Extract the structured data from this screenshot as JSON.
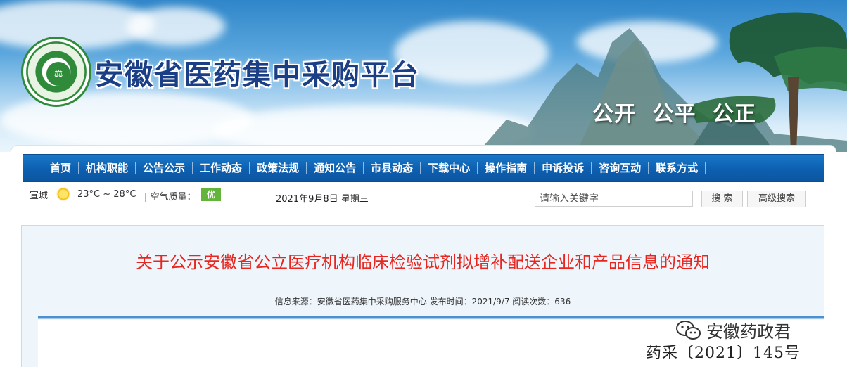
{
  "header": {
    "site_title": "安徽省医药集中采购平台",
    "slogan": [
      "公开",
      "公平",
      "公正"
    ]
  },
  "nav": {
    "items": [
      "首页",
      "机构职能",
      "公告公示",
      "工作动态",
      "政策法规",
      "通知公告",
      "市县动态",
      "下载中心",
      "操作指南",
      "申诉投诉",
      "咨询互动",
      "联系方式"
    ]
  },
  "infobar": {
    "city": "宣城",
    "weather_icon": "sun-icon",
    "temperature": "23°C ~ 28°C",
    "air_quality_label": "| 空气质量：",
    "air_quality_value": "优",
    "air_quality_color": "#62b53a",
    "date": "2021年9月8日  星期三"
  },
  "search": {
    "placeholder": "请输入关键字",
    "value": "",
    "search_label": "搜 索",
    "advanced_label": "高级搜索"
  },
  "article": {
    "title": "关于公示安徽省公立医疗机构临床检验试剂拟增补配送企业和产品信息的通知",
    "meta": "信息来源：安徽省医药集中采购服务中心  发布时间：2021/9/7  阅读次数：636",
    "title_color": "#e8261f",
    "doc_number": "药采〔2021〕145号"
  },
  "watermark": {
    "icon": "wechat-icon",
    "text": "安徽药政君"
  }
}
